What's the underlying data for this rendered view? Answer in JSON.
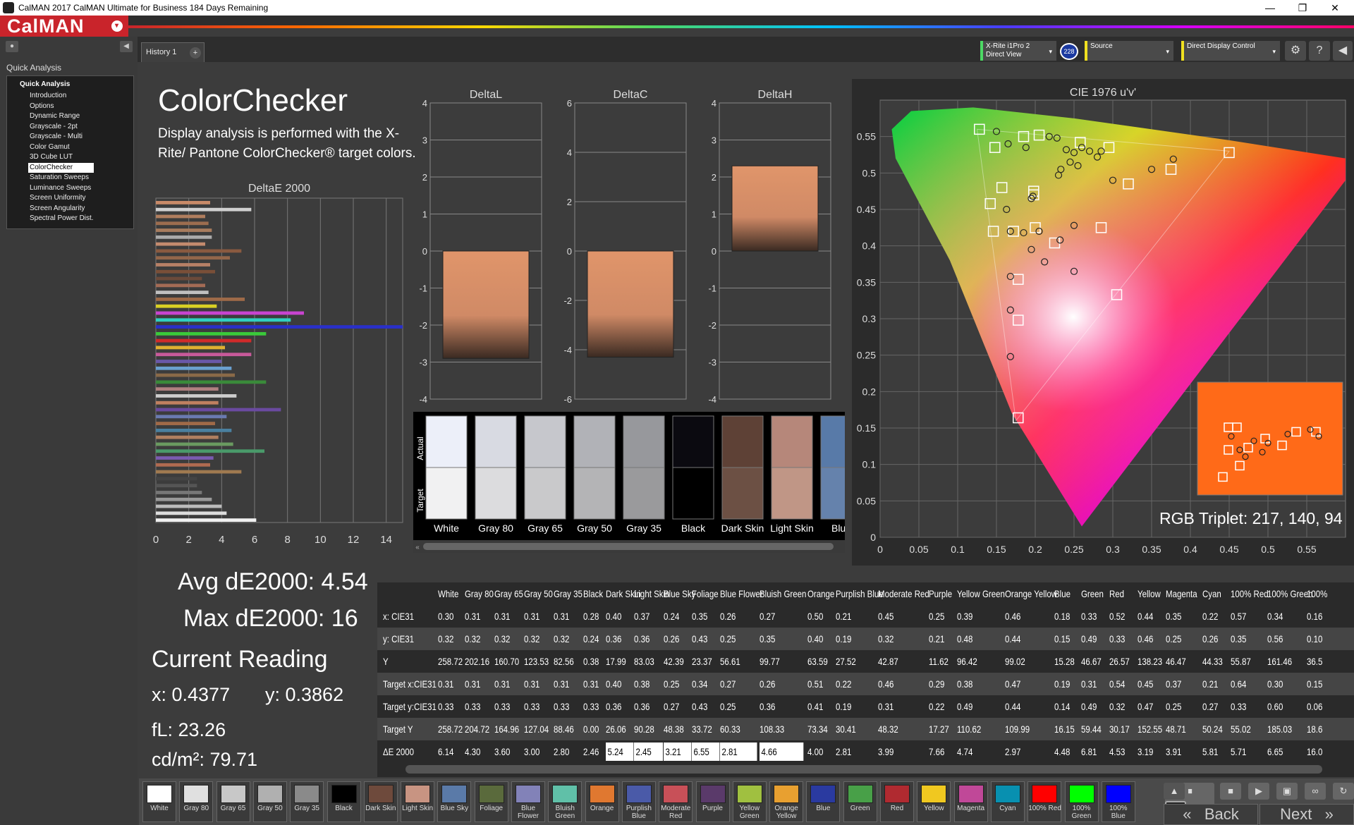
{
  "window": {
    "title": "CalMAN 2017 CalMAN Ultimate for Business 184 Days Remaining",
    "minimize": "—",
    "restore": "❐",
    "close": "✕"
  },
  "brand": {
    "name": "CalMAN",
    "dropdown": "▾"
  },
  "sidebar": {
    "header": "Quick Analysis",
    "group": "Quick Analysis",
    "items": [
      "Introduction",
      "Options",
      "Dynamic Range",
      "Grayscale - 2pt",
      "Grayscale - Multi",
      "Color Gamut",
      "3D Cube LUT",
      "ColorChecker",
      "Saturation Sweeps",
      "Luminance Sweeps",
      "Screen Uniformity",
      "Screen Angularity",
      "Spectral Power Dist."
    ],
    "selected": "ColorChecker"
  },
  "tab": {
    "label": "History 1",
    "add": "+"
  },
  "toolbar": {
    "meter": "X-Rite i1Pro 2\nDirect View",
    "meter_badge": "228",
    "source": "Source",
    "display": "Direct Display Control",
    "arrow": "▾",
    "settings": "⚙",
    "help": "?",
    "collapse": "◀"
  },
  "page": {
    "title": "ColorChecker",
    "description": "Display analysis is performed with the X-Rite/ Pantone ColorChecker® target colors."
  },
  "deltaE": {
    "title": "DeltaE 2000",
    "ticks": [
      "0",
      "2",
      "4",
      "6",
      "8",
      "10",
      "12",
      "14"
    ],
    "xmax": 15,
    "bars": [
      [
        3.3,
        "#c98a68"
      ],
      [
        5.8,
        "#d0d0d0"
      ],
      [
        3.0,
        "#b07e5e"
      ],
      [
        3.2,
        "#9c6d4f"
      ],
      [
        3.4,
        "#a87c5e"
      ],
      [
        3.4,
        "#aaaaaa"
      ],
      [
        3.0,
        "#c48b6e"
      ],
      [
        5.2,
        "#8a5a40"
      ],
      [
        4.5,
        "#93664a"
      ],
      [
        3.3,
        "#b78066"
      ],
      [
        3.6,
        "#7a4f38"
      ],
      [
        2.8,
        "#6b4a3a"
      ],
      [
        3.0,
        "#a46b55"
      ],
      [
        3.2,
        "#c0c0c0"
      ],
      [
        5.4,
        "#9e6a48"
      ],
      [
        3.7,
        "#d9d024"
      ],
      [
        9.0,
        "#c844d0"
      ],
      [
        8.2,
        "#30d0c0"
      ],
      [
        15.0,
        "#2a30c8"
      ],
      [
        6.7,
        "#3ac93a"
      ],
      [
        5.8,
        "#d02a2a"
      ],
      [
        4.2,
        "#e0b030"
      ],
      [
        5.8,
        "#c85a9a"
      ],
      [
        4.0,
        "#6a58a8"
      ],
      [
        4.6,
        "#6aa0d0"
      ],
      [
        4.8,
        "#8a6a48"
      ],
      [
        6.7,
        "#3a8a3a"
      ],
      [
        3.8,
        "#b08080"
      ],
      [
        4.9,
        "#cccccc"
      ],
      [
        3.8,
        "#c08060"
      ],
      [
        7.6,
        "#6a4aa0"
      ],
      [
        4.3,
        "#6a7ab0"
      ],
      [
        3.6,
        "#a06a48"
      ],
      [
        4.6,
        "#4a80a0"
      ],
      [
        3.8,
        "#b08060"
      ],
      [
        4.7,
        "#6a9a60"
      ],
      [
        6.6,
        "#4a9a6a"
      ],
      [
        3.5,
        "#7a5ab0"
      ],
      [
        3.3,
        "#b06a50"
      ],
      [
        5.2,
        "#a07a50"
      ],
      [
        2.5,
        "#444444"
      ],
      [
        2.5,
        "#555555"
      ],
      [
        2.8,
        "#777777"
      ],
      [
        3.4,
        "#999999"
      ],
      [
        4.0,
        "#bbbbbb"
      ],
      [
        4.3,
        "#dddddd"
      ],
      [
        6.1,
        "#f0f0f0"
      ]
    ]
  },
  "delta_l": {
    "title": "DeltaL",
    "ticks": [
      "4",
      "3",
      "2",
      "1",
      "0",
      "-1",
      "-2",
      "-3",
      "-4"
    ],
    "value": -2.9
  },
  "delta_c": {
    "title": "DeltaC",
    "ticks": [
      "6",
      "4",
      "2",
      "0",
      "-2",
      "-4",
      "-6"
    ],
    "value": -4.3
  },
  "delta_h": {
    "title": "DeltaH",
    "ticks": [
      "4",
      "3",
      "2",
      "1",
      "0",
      "-1",
      "-2",
      "-3",
      "-4"
    ],
    "value": 2.3
  },
  "patches": {
    "actual_label": "Actual",
    "target_label": "Target",
    "items": [
      [
        "White",
        "#eceff9",
        "#f1f1f2"
      ],
      [
        "Gray 80",
        "#d8dae2",
        "#dcdcde"
      ],
      [
        "Gray 65",
        "#c6c7cc",
        "#c9c9cb"
      ],
      [
        "Gray 50",
        "#b1b2b7",
        "#b4b4b6"
      ],
      [
        "Gray 35",
        "#97989c",
        "#9a9a9c"
      ],
      [
        "Black",
        "#0b0a10",
        "#000000"
      ],
      [
        "Dark Skin",
        "#5e4136",
        "#6c5044"
      ],
      [
        "Light Skin",
        "#b6877a",
        "#c09686"
      ],
      [
        "Blue",
        "#587aa8",
        "#6582ac"
      ]
    ]
  },
  "cie": {
    "title": "CIE 1976 u'v'",
    "xticks": [
      "0",
      "0.05",
      "0.1",
      "0.15",
      "0.2",
      "0.25",
      "0.3",
      "0.35",
      "0.4",
      "0.45",
      "0.5",
      "0.55"
    ],
    "yticks": [
      "0",
      "0.05",
      "0.1",
      "0.15",
      "0.2",
      "0.25",
      "0.3",
      "0.35",
      "0.4",
      "0.45",
      "0.5",
      "0.55"
    ],
    "targets": [
      [
        0.128,
        0.56
      ],
      [
        0.148,
        0.535
      ],
      [
        0.185,
        0.55
      ],
      [
        0.205,
        0.552
      ],
      [
        0.258,
        0.542
      ],
      [
        0.295,
        0.535
      ],
      [
        0.45,
        0.528
      ],
      [
        0.375,
        0.505
      ],
      [
        0.32,
        0.485
      ],
      [
        0.198,
        0.475
      ],
      [
        0.157,
        0.48
      ],
      [
        0.142,
        0.458
      ],
      [
        0.198,
        0.47
      ],
      [
        0.146,
        0.42
      ],
      [
        0.172,
        0.42
      ],
      [
        0.2,
        0.425
      ],
      [
        0.225,
        0.404
      ],
      [
        0.285,
        0.425
      ],
      [
        0.178,
        0.354
      ],
      [
        0.305,
        0.333
      ],
      [
        0.178,
        0.298
      ],
      [
        0.178,
        0.164
      ]
    ],
    "actual": [
      [
        0.15,
        0.557
      ],
      [
        0.165,
        0.54
      ],
      [
        0.188,
        0.535
      ],
      [
        0.218,
        0.55
      ],
      [
        0.228,
        0.548
      ],
      [
        0.24,
        0.532
      ],
      [
        0.25,
        0.528
      ],
      [
        0.26,
        0.535
      ],
      [
        0.27,
        0.53
      ],
      [
        0.28,
        0.522
      ],
      [
        0.3,
        0.49
      ],
      [
        0.35,
        0.505
      ],
      [
        0.378,
        0.519
      ],
      [
        0.285,
        0.53
      ],
      [
        0.245,
        0.515
      ],
      [
        0.233,
        0.505
      ],
      [
        0.255,
        0.51
      ],
      [
        0.23,
        0.497
      ],
      [
        0.195,
        0.465
      ],
      [
        0.163,
        0.45
      ],
      [
        0.168,
        0.42
      ],
      [
        0.185,
        0.418
      ],
      [
        0.205,
        0.42
      ],
      [
        0.195,
        0.395
      ],
      [
        0.232,
        0.408
      ],
      [
        0.212,
        0.378
      ],
      [
        0.168,
        0.358
      ],
      [
        0.25,
        0.428
      ],
      [
        0.25,
        0.365
      ],
      [
        0.168,
        0.312
      ],
      [
        0.168,
        0.248
      ],
      [
        0.197,
        0.468
      ]
    ],
    "inset_targets": [
      [
        0.11,
        0.2
      ],
      [
        0.14,
        0.2
      ],
      [
        0.24,
        0.25
      ],
      [
        0.35,
        0.22
      ],
      [
        0.11,
        0.3
      ],
      [
        0.18,
        0.29
      ],
      [
        0.3,
        0.28
      ],
      [
        0.42,
        0.22
      ],
      [
        0.15,
        0.37
      ],
      [
        0.09,
        0.42
      ]
    ],
    "inset_actual": [
      [
        0.12,
        0.24
      ],
      [
        0.2,
        0.26
      ],
      [
        0.25,
        0.27
      ],
      [
        0.32,
        0.23
      ],
      [
        0.4,
        0.21
      ],
      [
        0.43,
        0.24
      ],
      [
        0.15,
        0.3
      ],
      [
        0.17,
        0.33
      ],
      [
        0.23,
        0.31
      ]
    ]
  },
  "rgb_triplet": "RGB Triplet: 217, 140, 94",
  "stats": {
    "avg": "Avg dE2000: 4.54",
    "max": "Max dE2000: 16",
    "current": "Current Reading",
    "x": "x: 0.4377",
    "y": "y: 0.3862",
    "fl": "fL: 23.26",
    "cd": "cd/m²: 79.71"
  },
  "table": {
    "columns": [
      "White",
      "Gray 80",
      "Gray 65",
      "Gray 50",
      "Gray 35",
      "Black",
      "Dark Skin",
      "Light Skin",
      "Blue Sky",
      "Foliage",
      "Blue Flower",
      "Bluish Green",
      "Orange",
      "Purplish Blue",
      "Moderate Red",
      "Purple",
      "Yellow Green",
      "Orange Yellow",
      "Blue",
      "Green",
      "Red",
      "Yellow",
      "Magenta",
      "Cyan",
      "100% Red",
      "100% Green",
      "100%"
    ],
    "rows": [
      {
        "label": "x: CIE31",
        "values": [
          "0.30",
          "0.31",
          "0.31",
          "0.31",
          "0.31",
          "0.28",
          "0.40",
          "0.37",
          "0.24",
          "0.35",
          "0.26",
          "0.27",
          "0.50",
          "0.21",
          "0.45",
          "0.25",
          "0.39",
          "0.46",
          "0.18",
          "0.33",
          "0.52",
          "0.44",
          "0.35",
          "0.22",
          "0.57",
          "0.34",
          "0.16"
        ]
      },
      {
        "label": "y: CIE31",
        "values": [
          "0.32",
          "0.32",
          "0.32",
          "0.32",
          "0.32",
          "0.24",
          "0.36",
          "0.36",
          "0.26",
          "0.43",
          "0.25",
          "0.35",
          "0.40",
          "0.19",
          "0.32",
          "0.21",
          "0.48",
          "0.44",
          "0.15",
          "0.49",
          "0.33",
          "0.46",
          "0.25",
          "0.26",
          "0.35",
          "0.56",
          "0.10"
        ]
      },
      {
        "label": "Y",
        "values": [
          "258.72",
          "202.16",
          "160.70",
          "123.53",
          "82.56",
          "0.38",
          "17.99",
          "83.03",
          "42.39",
          "23.37",
          "56.61",
          "99.77",
          "63.59",
          "27.52",
          "42.87",
          "11.62",
          "96.42",
          "99.02",
          "15.28",
          "46.67",
          "26.57",
          "138.23",
          "46.47",
          "44.33",
          "55.87",
          "161.46",
          "36.5"
        ]
      },
      {
        "label": "Target x:CIE31",
        "values": [
          "0.31",
          "0.31",
          "0.31",
          "0.31",
          "0.31",
          "0.31",
          "0.40",
          "0.38",
          "0.25",
          "0.34",
          "0.27",
          "0.26",
          "0.51",
          "0.22",
          "0.46",
          "0.29",
          "0.38",
          "0.47",
          "0.19",
          "0.31",
          "0.54",
          "0.45",
          "0.37",
          "0.21",
          "0.64",
          "0.30",
          "0.15"
        ]
      },
      {
        "label": "Target y:CIE31",
        "values": [
          "0.33",
          "0.33",
          "0.33",
          "0.33",
          "0.33",
          "0.33",
          "0.36",
          "0.36",
          "0.27",
          "0.43",
          "0.25",
          "0.36",
          "0.41",
          "0.19",
          "0.31",
          "0.22",
          "0.49",
          "0.44",
          "0.14",
          "0.49",
          "0.32",
          "0.47",
          "0.25",
          "0.27",
          "0.33",
          "0.60",
          "0.06"
        ]
      },
      {
        "label": "Target Y",
        "values": [
          "258.72",
          "204.72",
          "164.96",
          "127.04",
          "88.46",
          "0.00",
          "26.06",
          "90.28",
          "48.38",
          "33.72",
          "60.33",
          "108.33",
          "73.34",
          "30.41",
          "48.32",
          "17.27",
          "110.62",
          "109.99",
          "16.15",
          "59.44",
          "30.17",
          "152.55",
          "48.71",
          "50.24",
          "55.02",
          "185.03",
          "18.6"
        ]
      },
      {
        "label": "ΔE 2000",
        "values": [
          "6.14",
          "4.30",
          "3.60",
          "3.00",
          "2.80",
          "2.46",
          "5.24",
          "2.45",
          "3.21",
          "6.55",
          "2.81",
          "4.66",
          "4.00",
          "2.81",
          "3.99",
          "7.66",
          "4.74",
          "2.97",
          "4.48",
          "6.81",
          "4.53",
          "3.19",
          "3.91",
          "5.81",
          "5.71",
          "6.65",
          "16.0"
        ],
        "white_cells": [
          6,
          7,
          8,
          9,
          10,
          11
        ]
      }
    ]
  },
  "swatches": [
    [
      "White",
      "#ffffff"
    ],
    [
      "Gray 80",
      "#e0e0e0"
    ],
    [
      "Gray 65",
      "#c8c8c8"
    ],
    [
      "Gray 50",
      "#b0b0b0"
    ],
    [
      "Gray 35",
      "#8a8a8a"
    ],
    [
      "Black",
      "#000000"
    ],
    [
      "Dark Skin",
      "#6e4a3c"
    ],
    [
      "Light Skin",
      "#c89482"
    ],
    [
      "Blue Sky",
      "#5a7aa8"
    ],
    [
      "Foliage",
      "#5a6a3c"
    ],
    [
      "Blue\nFlower",
      "#8282b8"
    ],
    [
      "Bluish\nGreen",
      "#60c0a8"
    ],
    [
      "Orange",
      "#e07830"
    ],
    [
      "Purplish\nBlue",
      "#4a5aa8"
    ],
    [
      "Moderate\nRed",
      "#c85058"
    ],
    [
      "Purple",
      "#5a3a6a"
    ],
    [
      "Yellow\nGreen",
      "#a0c040"
    ],
    [
      "Orange\nYellow",
      "#e8a030"
    ],
    [
      "Blue",
      "#2a3aa0"
    ],
    [
      "Green",
      "#48a048"
    ],
    [
      "Red",
      "#b02a30"
    ],
    [
      "Yellow",
      "#f0c820"
    ],
    [
      "Magenta",
      "#c04898"
    ],
    [
      "Cyan",
      "#0890b0"
    ],
    [
      "100% Red",
      "#ff0000"
    ],
    [
      "100%\nGreen",
      "#00ff00"
    ],
    [
      "100%\nBlue",
      "#0000ff"
    ]
  ],
  "controls": {
    "back": "Back",
    "next": "Next",
    "back_icon": "«",
    "next_icon": "»"
  }
}
